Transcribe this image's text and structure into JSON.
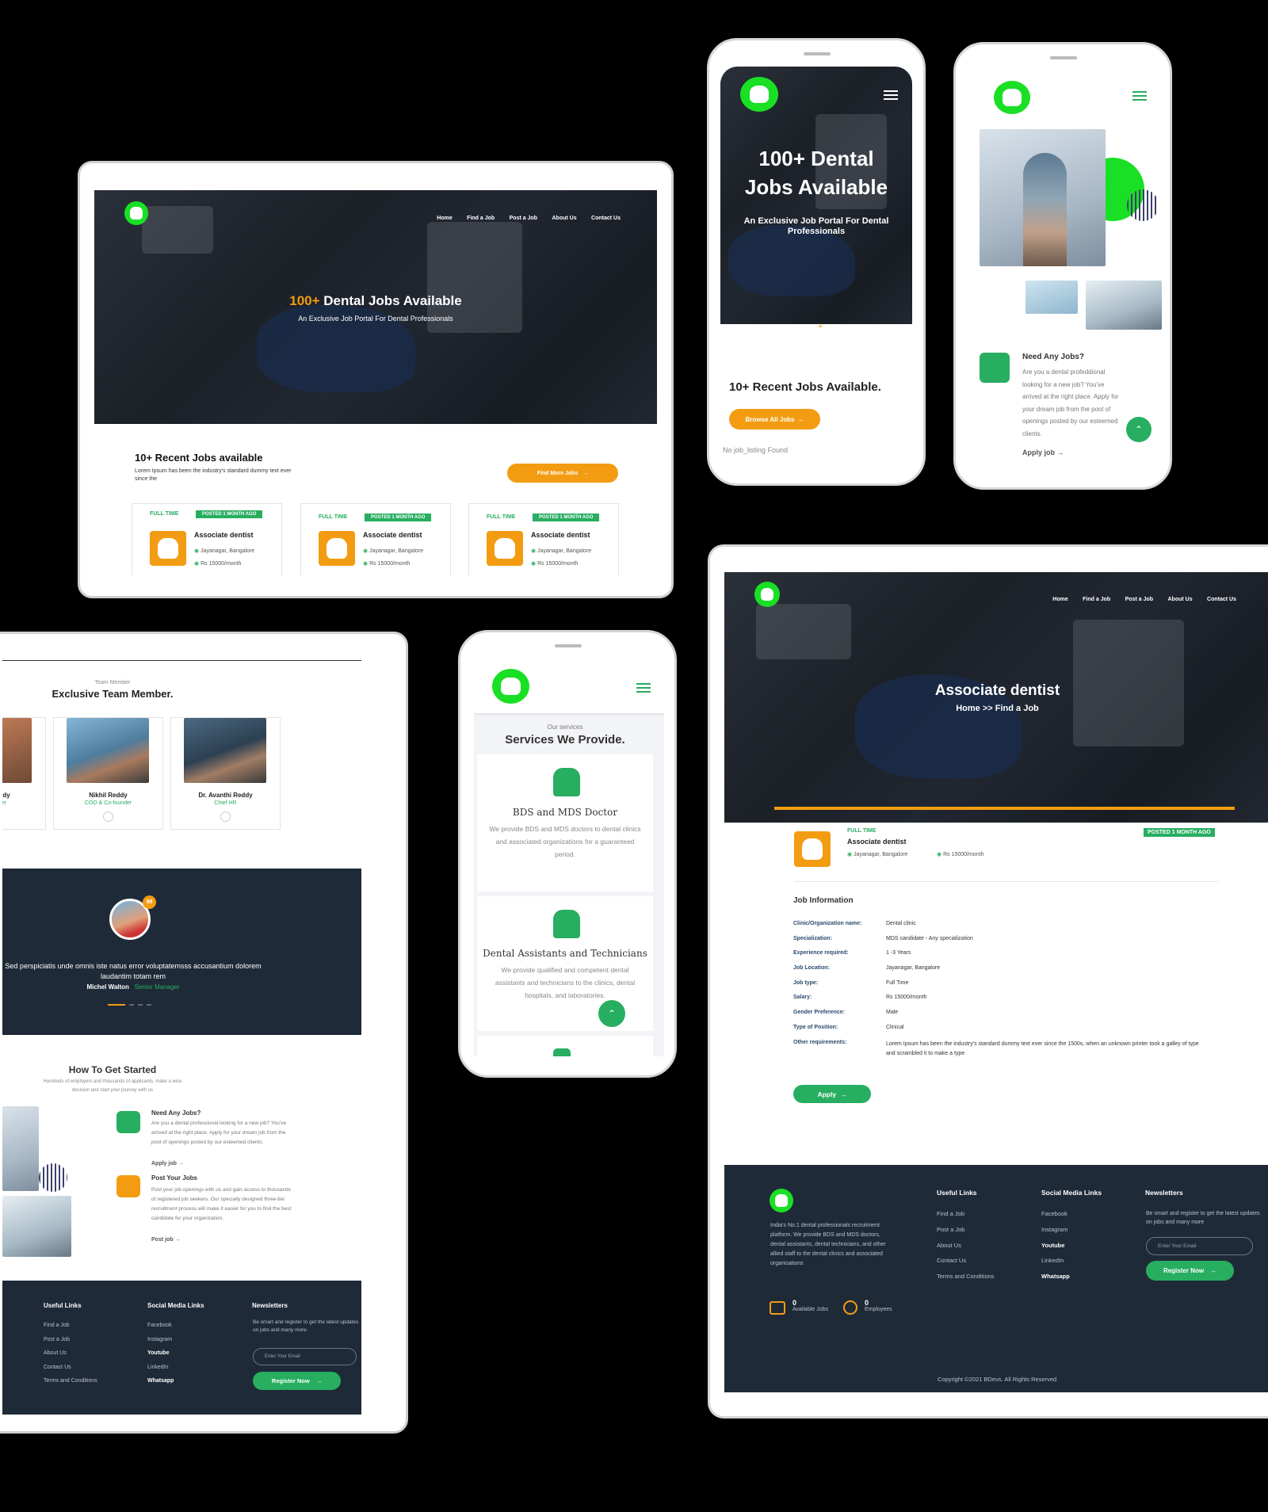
{
  "tablet1": {
    "nav": [
      "Home",
      "Find a Job",
      "Post a Job",
      "About Us",
      "Contact Us"
    ],
    "hero_accent": "100+",
    "hero_title": " Dental Jobs Available",
    "hero_sub": "An Exclusive Job Portal For Dental Professionals",
    "recent_title": "10+ Recent Jobs available",
    "recent_desc": "Lorem Ipsum has been the industry's standard dummy text ever since the",
    "find_more": "Find More Jobs",
    "cards": [
      {
        "type": "FULL TIME",
        "posted": "POSTED 1 MONTH AGO",
        "title": "Associate dentist",
        "location": "Jayanagar, Bangalore",
        "salary": "Rs 15000/month"
      },
      {
        "type": "FULL TIME",
        "posted": "POSTED 1 MONTH AGO",
        "title": "Associate dentist",
        "location": "Jayanagar, Bangalore",
        "salary": "Rs 15000/month"
      },
      {
        "type": "FULL TIME",
        "posted": "POSTED 1 MONTH AGO",
        "title": "Associate dentist",
        "location": "Jayanagar, Bangalore",
        "salary": "Rs 15000/month"
      }
    ]
  },
  "phone1": {
    "logo_text": "DENTAL",
    "hero_title": "100+ Dental Jobs Available",
    "hero_sub": "An Exclusive Job Portal For Dental Professionals",
    "plus": "+",
    "recent": "10+ Recent Jobs Available.",
    "browse": "Browse All Jobs",
    "no_listing": "No job_listing Found"
  },
  "phone2": {
    "logo_text": "DENTAL",
    "need_title": "Need Any Jobs?",
    "need_desc": "Are you a dental profeddional looking for a new job? You've arrived at the right place. Apply for your dream job from the pool of openings posted by our esteemed clients.",
    "apply": "Apply job"
  },
  "tablet2": {
    "team_kicker": "Team Member",
    "team_title": "Exclusive Team Member.",
    "members": [
      {
        "name": "eddy",
        "role": "nder"
      },
      {
        "name": "Nikhil Reddy",
        "role": "COO & Co-founder"
      },
      {
        "name": "Dr. Avanthi Reddy",
        "role": "Chief HR"
      }
    ],
    "quote_badge": "99",
    "quote": "Sed perspiciatis unde omnis iste natus error voluptatemsss accusantium dolorem laudantim totam rem",
    "quote_author": "Michel Walton",
    "quote_role": "Senior Manager",
    "how_title": "How To Get Started",
    "how_sub": "Hundreds of employers and thousands of applicants, make a wise decision and start your journey with us",
    "need_title": "Need Any Jobs?",
    "need_desc": "Are you a dental professional looking for a new job? You've arrived at the right place. Apply for your dream job from the pool of openings posted by our esteemed clients.",
    "apply": "Apply job",
    "post_title": "Post Your Jobs",
    "post_desc": "Post your job openings with us and gain access to thousands of registered job seekers. Our specially designed three-tier recruitment process will make it easier for you to find the best candidate for your organization.",
    "post": "Post job",
    "footer": {
      "useful": "Useful Links",
      "useful_items": [
        "Find a Job",
        "Post a Job",
        "About Us",
        "Contact Us",
        "Terms and Conditions"
      ],
      "social": "Social Media Links",
      "social_items": [
        "Facebook",
        "Instagram",
        "Youtube",
        "LinkedIn",
        "Whatsapp"
      ],
      "news": "Newsletters",
      "news_desc": "Be smart and register to get the latest updates on jobs and many more",
      "email_placeholder": "Enter Your Email",
      "register": "Register Now"
    }
  },
  "phone3": {
    "logo_text": "DENTAL",
    "kicker": "Our services",
    "title": "Services We Provide.",
    "svc1_title": "BDS and MDS Doctor",
    "svc1_desc": "We provide BDS and MDS doctors to dental clinics and associated organizations for a guaranteed period.",
    "svc2_title": "Dental Assistants and Technicians",
    "svc2_desc": "We provide qualified and competent dental assistants and technicians to the clinics, dental hospitals, and laboratories."
  },
  "desktop": {
    "nav": [
      "Home",
      "Find a Job",
      "Post a Job",
      "About Us",
      "Contact Us"
    ],
    "hero_title": "Associate dentist",
    "breadcrumb": "Home >> Find a Job",
    "job_type": "FULL TIME",
    "posted": "POSTED 1 MONTH AGO",
    "job_title": "Associate dentist",
    "location": "Jayanagar, Bangalore",
    "salary": "Rs 15000/month",
    "info_title": "Job Information",
    "info": [
      {
        "k": "Clinic/Organization name:",
        "v": "Dental clinic"
      },
      {
        "k": "Specialization:",
        "v": "MDS candidate - Any specialization"
      },
      {
        "k": "Experience required:",
        "v": "1 -3 Years"
      },
      {
        "k": "Job Location:",
        "v": "Jayanagar, Bangalore"
      },
      {
        "k": "Job type:",
        "v": "Full Time"
      },
      {
        "k": "Salary:",
        "v": "Rs 15000/month"
      },
      {
        "k": "Gender Preference:",
        "v": "Male"
      },
      {
        "k": "Type of Position:",
        "v": "Clinical"
      },
      {
        "k": "Other requirements:",
        "v": "Lorem Ipsum has been the industry's standard dummy text ever since the 1500s, when an unknown printer took a galley of type and scrambled it to make a type"
      }
    ],
    "apply": "Apply",
    "footer": {
      "about": "India's No.1 dental professionals recruitment platform. We provide BDS and MDS doctors, dental assistants, dental technicians, and other allied staff to the dental clinics and associated organisations",
      "useful": "Useful Links",
      "useful_items": [
        "Find a Job",
        "Post a Job",
        "About Us",
        "Contact Us",
        "Terms and Conditions"
      ],
      "social": "Social Media Links",
      "social_items": [
        "Facebook",
        "Instagram",
        "Youtube",
        "LinkedIn",
        "Whatsapp"
      ],
      "news": "Newsletters",
      "news_desc": "Be smart and register to get the latest updates on jobs and many more",
      "email_placeholder": "Enter Your Email",
      "register": "Register Now",
      "jobs_count": "0",
      "jobs_label": "Available Jobs",
      "emp_count": "0",
      "emp_label": "Employees",
      "copyright": "Copyright ©2021 BDevs. All Rights Reserved"
    }
  },
  "colors": {
    "green": "#27ae60",
    "orange": "#f39c12",
    "dark": "#1f2a38",
    "logo_green": "#19e024"
  }
}
